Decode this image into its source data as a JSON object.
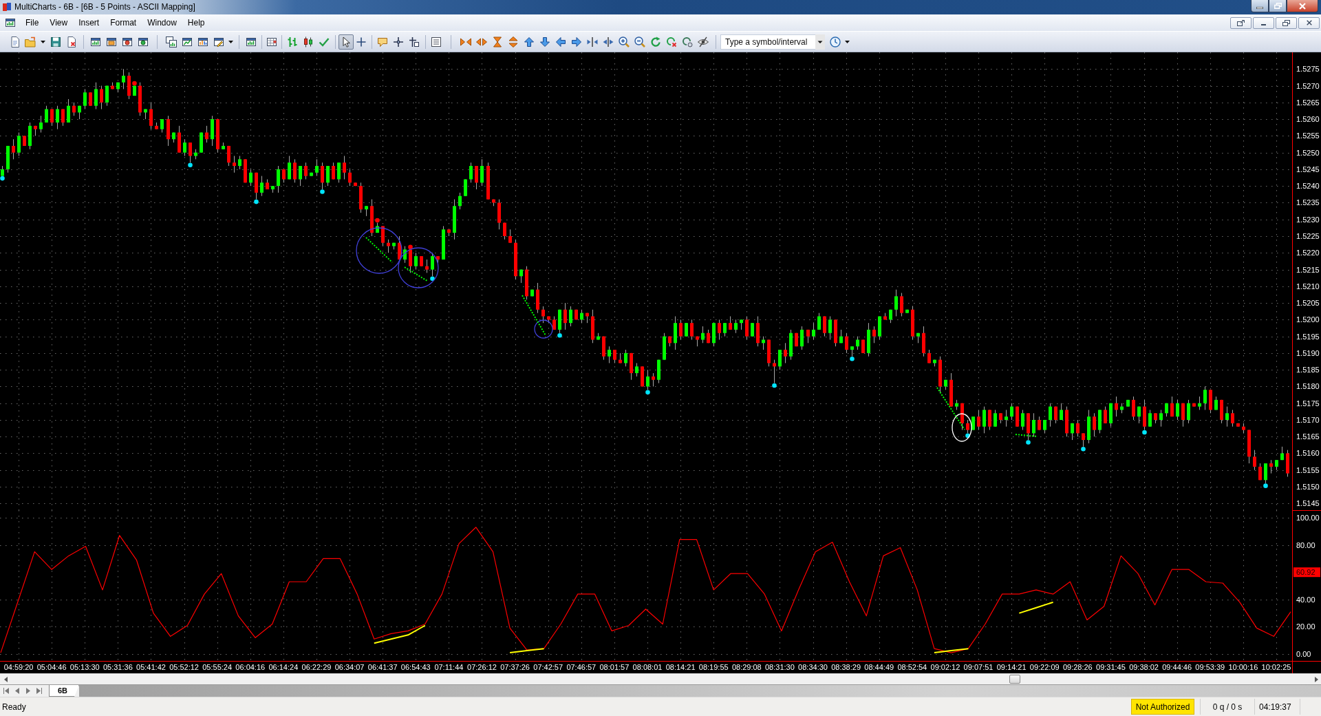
{
  "window": {
    "title": "MultiCharts - 6B - [6B - 5 Points - ASCII Mapping]"
  },
  "menu": [
    "File",
    "View",
    "Insert",
    "Format",
    "Window",
    "Help"
  ],
  "toolbar": {
    "cursor_modes": [
      {
        "selected": true
      },
      {
        "selected": false
      }
    ],
    "symbol_field": {
      "placeholder": "Type a symbol/interval"
    }
  },
  "price_chart": {
    "chart_data": {
      "type": "candlestick",
      "grid": true,
      "ylim": [
        1.5143,
        1.528
      ],
      "yticks": [
        {
          "value": 1.5275,
          "label": "1.5275"
        },
        {
          "value": 1.527,
          "label": "1.5270"
        },
        {
          "value": 1.5265,
          "label": "1.5265"
        },
        {
          "value": 1.526,
          "label": "1.5260"
        },
        {
          "value": 1.5255,
          "label": "1.5255"
        },
        {
          "value": 1.525,
          "label": "1.5250"
        },
        {
          "value": 1.5245,
          "label": "1.5245"
        },
        {
          "value": 1.524,
          "label": "1.5240"
        },
        {
          "value": 1.5235,
          "label": "1.5235"
        },
        {
          "value": 1.523,
          "label": "1.5230"
        },
        {
          "value": 1.5225,
          "label": "1.5225"
        },
        {
          "value": 1.522,
          "label": "1.5220"
        },
        {
          "value": 1.5215,
          "label": "1.5215"
        },
        {
          "value": 1.521,
          "label": "1.5210"
        },
        {
          "value": 1.5205,
          "label": "1.5205"
        },
        {
          "value": 1.52,
          "label": "1.5200"
        },
        {
          "value": 1.5195,
          "label": "1.5195"
        },
        {
          "value": 1.519,
          "label": "1.5190"
        },
        {
          "value": 1.5185,
          "label": "1.5185"
        },
        {
          "value": 1.518,
          "label": "1.5180"
        },
        {
          "value": 1.5175,
          "label": "1.5175"
        },
        {
          "value": 1.517,
          "label": "1.5170"
        },
        {
          "value": 1.5165,
          "label": "1.5165"
        },
        {
          "value": 1.516,
          "label": "1.5160"
        },
        {
          "value": 1.5155,
          "label": "1.5155"
        },
        {
          "value": 1.515,
          "label": "1.5150"
        },
        {
          "value": 1.5145,
          "label": "1.5145"
        }
      ],
      "ohlc": [
        [
          1.5243,
          1.5246,
          1.5243,
          1.5245
        ],
        [
          1.5245,
          1.5252,
          1.5244,
          1.5252
        ],
        [
          1.5252,
          1.5254,
          1.5248,
          1.525
        ],
        [
          1.525,
          1.5256,
          1.5249,
          1.5255
        ],
        [
          1.5255,
          1.5255,
          1.5252,
          1.5252
        ],
        [
          1.5252,
          1.5259,
          1.5251,
          1.5258
        ],
        [
          1.5258,
          1.5258,
          1.5255,
          1.5257
        ],
        [
          1.5257,
          1.5261,
          1.5256,
          1.5259
        ],
        [
          1.5259,
          1.5264,
          1.5259,
          1.5263
        ],
        [
          1.5263,
          1.5263,
          1.5258,
          1.5259
        ],
        [
          1.5259,
          1.5264,
          1.5257,
          1.5263
        ],
        [
          1.5263,
          1.5263,
          1.5258,
          1.5259
        ],
        [
          1.5259,
          1.5266,
          1.5259,
          1.5264
        ],
        [
          1.5264,
          1.5265,
          1.5261,
          1.5262
        ],
        [
          1.5262,
          1.5264,
          1.526,
          1.5264
        ],
        [
          1.5264,
          1.5269,
          1.5263,
          1.5268
        ],
        [
          1.5268,
          1.5268,
          1.5264,
          1.5264
        ],
        [
          1.5264,
          1.5271,
          1.5263,
          1.5269
        ],
        [
          1.5269,
          1.527,
          1.5263,
          1.5265
        ],
        [
          1.5265,
          1.527,
          1.5264,
          1.527
        ],
        [
          1.527,
          1.5271,
          1.5269,
          1.5269
        ],
        [
          1.5269,
          1.5271,
          1.5268,
          1.5271
        ],
        [
          1.5271,
          1.5275,
          1.5269,
          1.5273
        ],
        [
          1.5273,
          1.5274,
          1.5266,
          1.5267
        ],
        [
          1.5267,
          1.527,
          1.5267,
          1.527
        ],
        [
          1.527,
          1.5271,
          1.5261,
          1.5262
        ],
        [
          1.5262,
          1.5263,
          1.526,
          1.5263
        ],
        [
          1.5263,
          1.5265,
          1.5257,
          1.5258
        ],
        [
          1.5258,
          1.5259,
          1.5257,
          1.5257
        ],
        [
          1.5257,
          1.526,
          1.5256,
          1.526
        ],
        [
          1.526,
          1.5261,
          1.5252,
          1.5254
        ],
        [
          1.5254,
          1.5256,
          1.5253,
          1.5256
        ],
        [
          1.5256,
          1.5258,
          1.525,
          1.525
        ],
        [
          1.525,
          1.5254,
          1.5249,
          1.5253
        ],
        [
          1.5253,
          1.5253,
          1.5247,
          1.5249
        ],
        [
          1.5249,
          1.5251,
          1.5248,
          1.525
        ],
        [
          1.525,
          1.5256,
          1.525,
          1.5256
        ],
        [
          1.5256,
          1.5258,
          1.5253,
          1.5254
        ],
        [
          1.5254,
          1.5261,
          1.5252,
          1.526
        ],
        [
          1.526,
          1.526,
          1.525,
          1.5251
        ],
        [
          1.5251,
          1.5253,
          1.5251,
          1.5252
        ],
        [
          1.5252,
          1.5252,
          1.5246,
          1.5247
        ],
        [
          1.5247,
          1.5249,
          1.5244,
          1.5246
        ],
        [
          1.5246,
          1.5249,
          1.5245,
          1.5248
        ],
        [
          1.5248,
          1.5248,
          1.5241,
          1.5241
        ],
        [
          1.5241,
          1.5245,
          1.524,
          1.5244
        ],
        [
          1.5244,
          1.5244,
          1.5236,
          1.5238
        ],
        [
          1.5238,
          1.5243,
          1.5237,
          1.5241
        ],
        [
          1.5241,
          1.5242,
          1.5239,
          1.5239
        ],
        [
          1.5239,
          1.524,
          1.5238,
          1.524
        ],
        [
          1.524,
          1.5246,
          1.5238,
          1.5245
        ],
        [
          1.5245,
          1.5245,
          1.5241,
          1.5242
        ],
        [
          1.5242,
          1.5249,
          1.5242,
          1.5247
        ],
        [
          1.5247,
          1.5248,
          1.5241,
          1.5242
        ],
        [
          1.5242,
          1.5246,
          1.524,
          1.5246
        ],
        [
          1.5246,
          1.5247,
          1.5242,
          1.5243
        ],
        [
          1.5243,
          1.5244,
          1.5243,
          1.5244
        ],
        [
          1.5244,
          1.5248,
          1.5243,
          1.5246
        ],
        [
          1.5246,
          1.5247,
          1.5239,
          1.5241
        ],
        [
          1.5241,
          1.5246,
          1.524,
          1.5246
        ],
        [
          1.5246,
          1.5247,
          1.5242,
          1.5242
        ],
        [
          1.5242,
          1.5247,
          1.5241,
          1.5247
        ],
        [
          1.5247,
          1.5249,
          1.5242,
          1.5244
        ],
        [
          1.5244,
          1.5245,
          1.524,
          1.5241
        ],
        [
          1.5241,
          1.5241,
          1.524,
          1.524
        ],
        [
          1.524,
          1.5241,
          1.5232,
          1.5233
        ],
        [
          1.5233,
          1.5234,
          1.5231,
          1.5234
        ],
        [
          1.5234,
          1.5236,
          1.5225,
          1.5226
        ],
        [
          1.5226,
          1.5229,
          1.5226,
          1.5228
        ],
        [
          1.5228,
          1.5228,
          1.5222,
          1.5223
        ],
        [
          1.5223,
          1.5224,
          1.522,
          1.5222
        ],
        [
          1.5222,
          1.5223,
          1.5221,
          1.5223
        ],
        [
          1.5223,
          1.5225,
          1.5218,
          1.5218
        ],
        [
          1.5218,
          1.5222,
          1.5217,
          1.5221
        ],
        [
          1.5221,
          1.5221,
          1.5214,
          1.5216
        ],
        [
          1.5216,
          1.522,
          1.5215,
          1.5219
        ],
        [
          1.5219,
          1.5219,
          1.5216,
          1.5216
        ],
        [
          1.5216,
          1.5218,
          1.5214,
          1.5215
        ],
        [
          1.5215,
          1.522,
          1.5213,
          1.5219
        ],
        [
          1.5219,
          1.5219,
          1.5217,
          1.5218
        ],
        [
          1.5218,
          1.5228,
          1.5218,
          1.5227
        ],
        [
          1.5227,
          1.5227,
          1.5225,
          1.5226
        ],
        [
          1.5226,
          1.5236,
          1.5224,
          1.5234
        ],
        [
          1.5234,
          1.5238,
          1.5233,
          1.5237
        ],
        [
          1.5237,
          1.5242,
          1.5237,
          1.5242
        ],
        [
          1.5242,
          1.5247,
          1.5241,
          1.5246
        ],
        [
          1.5246,
          1.5246,
          1.5239,
          1.5241
        ],
        [
          1.5241,
          1.5248,
          1.524,
          1.5246
        ],
        [
          1.5246,
          1.5247,
          1.5236,
          1.5236
        ],
        [
          1.5236,
          1.5236,
          1.5234,
          1.5235
        ],
        [
          1.5235,
          1.5236,
          1.5227,
          1.5229
        ],
        [
          1.5229,
          1.5229,
          1.5224,
          1.5225
        ],
        [
          1.5225,
          1.5227,
          1.5223,
          1.5223
        ],
        [
          1.5223,
          1.5224,
          1.5212,
          1.5213
        ],
        [
          1.5213,
          1.5215,
          1.5211,
          1.5215
        ],
        [
          1.5215,
          1.5216,
          1.5206,
          1.5207
        ],
        [
          1.5207,
          1.5209,
          1.5207,
          1.5209
        ],
        [
          1.5209,
          1.5211,
          1.5202,
          1.5203
        ],
        [
          1.5203,
          1.5204,
          1.5199,
          1.5201
        ],
        [
          1.5201,
          1.5201,
          1.5199,
          1.52
        ],
        [
          1.52,
          1.5201,
          1.5197,
          1.5197
        ],
        [
          1.5197,
          1.5203,
          1.5196,
          1.5203
        ],
        [
          1.5203,
          1.5205,
          1.5197,
          1.5199
        ],
        [
          1.5199,
          1.5204,
          1.5198,
          1.5203
        ],
        [
          1.5203,
          1.5203,
          1.52,
          1.52
        ],
        [
          1.52,
          1.5203,
          1.5199,
          1.5202
        ],
        [
          1.5202,
          1.5202,
          1.5199,
          1.5201
        ],
        [
          1.5201,
          1.5203,
          1.5193,
          1.5194
        ],
        [
          1.5194,
          1.5196,
          1.5194,
          1.5195
        ],
        [
          1.5195,
          1.5195,
          1.5188,
          1.5189
        ],
        [
          1.5189,
          1.5192,
          1.5187,
          1.5191
        ],
        [
          1.5191,
          1.5191,
          1.5187,
          1.5188
        ],
        [
          1.5188,
          1.519,
          1.5187,
          1.5187
        ],
        [
          1.5187,
          1.5191,
          1.5186,
          1.519
        ],
        [
          1.519,
          1.519,
          1.5182,
          1.5184
        ],
        [
          1.5184,
          1.5187,
          1.5183,
          1.5186
        ],
        [
          1.5186,
          1.5186,
          1.518,
          1.518
        ],
        [
          1.518,
          1.5185,
          1.5179,
          1.5183
        ],
        [
          1.5183,
          1.5184,
          1.518,
          1.5182
        ],
        [
          1.5182,
          1.5188,
          1.5181,
          1.5188
        ],
        [
          1.5188,
          1.5196,
          1.5188,
          1.5195
        ],
        [
          1.5195,
          1.5195,
          1.5192,
          1.5193
        ],
        [
          1.5193,
          1.5201,
          1.5191,
          1.5199
        ],
        [
          1.5199,
          1.52,
          1.5194,
          1.5195
        ],
        [
          1.5195,
          1.5199,
          1.5195,
          1.5199
        ],
        [
          1.5199,
          1.52,
          1.5194,
          1.5195
        ],
        [
          1.5195,
          1.5195,
          1.5192,
          1.5194
        ],
        [
          1.5194,
          1.5198,
          1.5193,
          1.5196
        ],
        [
          1.5196,
          1.5197,
          1.5193,
          1.5193
        ],
        [
          1.5193,
          1.5199,
          1.5192,
          1.5199
        ],
        [
          1.5199,
          1.52,
          1.5194,
          1.5196
        ],
        [
          1.5196,
          1.5199,
          1.5195,
          1.5199
        ],
        [
          1.5199,
          1.5201,
          1.5197,
          1.5197
        ],
        [
          1.5197,
          1.52,
          1.5196,
          1.5199
        ],
        [
          1.5199,
          1.52,
          1.5197,
          1.52
        ],
        [
          1.52,
          1.5201,
          1.5194,
          1.5195
        ],
        [
          1.5195,
          1.5199,
          1.5195,
          1.5199
        ],
        [
          1.5199,
          1.5201,
          1.5192,
          1.5193
        ],
        [
          1.5193,
          1.5195,
          1.5191,
          1.5194
        ],
        [
          1.5194,
          1.5194,
          1.5186,
          1.5187
        ],
        [
          1.5187,
          1.5188,
          1.5181,
          1.5186
        ],
        [
          1.5186,
          1.5191,
          1.5185,
          1.5191
        ],
        [
          1.5191,
          1.5193,
          1.5187,
          1.5189
        ],
        [
          1.5189,
          1.5197,
          1.5188,
          1.5196
        ],
        [
          1.5196,
          1.5196,
          1.5192,
          1.5192
        ],
        [
          1.5192,
          1.5198,
          1.5191,
          1.5197
        ],
        [
          1.5197,
          1.5197,
          1.5193,
          1.5195
        ],
        [
          1.5195,
          1.5199,
          1.5194,
          1.5197
        ],
        [
          1.5197,
          1.5202,
          1.5197,
          1.5201
        ],
        [
          1.5201,
          1.5201,
          1.5195,
          1.5196
        ],
        [
          1.5196,
          1.5201,
          1.5194,
          1.52
        ],
        [
          1.52,
          1.52,
          1.5192,
          1.5193
        ],
        [
          1.5193,
          1.5197,
          1.5193,
          1.5195
        ],
        [
          1.5195,
          1.5196,
          1.519,
          1.5191
        ],
        [
          1.5191,
          1.5192,
          1.5189,
          1.5192
        ],
        [
          1.5192,
          1.5195,
          1.5191,
          1.5194
        ],
        [
          1.5194,
          1.5194,
          1.519,
          1.519
        ],
        [
          1.519,
          1.5199,
          1.5189,
          1.5197
        ],
        [
          1.5197,
          1.5198,
          1.5193,
          1.5195
        ],
        [
          1.5195,
          1.5201,
          1.5194,
          1.5201
        ],
        [
          1.5201,
          1.5202,
          1.52,
          1.52
        ],
        [
          1.52,
          1.5203,
          1.5199,
          1.5203
        ],
        [
          1.5203,
          1.5209,
          1.5201,
          1.5207
        ],
        [
          1.5207,
          1.5208,
          1.5201,
          1.5202
        ],
        [
          1.5202,
          1.5203,
          1.5202,
          1.5203
        ],
        [
          1.5203,
          1.5204,
          1.5194,
          1.5195
        ],
        [
          1.5195,
          1.5196,
          1.5193,
          1.5196
        ],
        [
          1.5196,
          1.5198,
          1.5189,
          1.519
        ],
        [
          1.519,
          1.5191,
          1.5187,
          1.5187
        ],
        [
          1.5187,
          1.5188,
          1.5186,
          1.5188
        ],
        [
          1.5188,
          1.5189,
          1.5178,
          1.518
        ],
        [
          1.518,
          1.5182,
          1.5179,
          1.5182
        ],
        [
          1.5182,
          1.5184,
          1.5174,
          1.5174
        ],
        [
          1.5174,
          1.5176,
          1.5173,
          1.5175
        ],
        [
          1.5175,
          1.5175,
          1.5167,
          1.5169
        ],
        [
          1.5169,
          1.517,
          1.5166,
          1.5167
        ],
        [
          1.5167,
          1.5171,
          1.5167,
          1.5171
        ],
        [
          1.5171,
          1.5173,
          1.5167,
          1.5168
        ],
        [
          1.5168,
          1.5174,
          1.5166,
          1.5173
        ],
        [
          1.5173,
          1.5173,
          1.5167,
          1.5168
        ],
        [
          1.5168,
          1.5173,
          1.5168,
          1.5172
        ],
        [
          1.5172,
          1.5172,
          1.5169,
          1.517
        ],
        [
          1.517,
          1.5173,
          1.5168,
          1.5171
        ],
        [
          1.5171,
          1.5175,
          1.517,
          1.5174
        ],
        [
          1.5174,
          1.5174,
          1.5168,
          1.5168
        ],
        [
          1.5168,
          1.5173,
          1.5167,
          1.5172
        ],
        [
          1.5172,
          1.5172,
          1.5164,
          1.5166
        ],
        [
          1.5166,
          1.5172,
          1.5165,
          1.517
        ],
        [
          1.517,
          1.5171,
          1.5167,
          1.5167
        ],
        [
          1.5167,
          1.517,
          1.5166,
          1.517
        ],
        [
          1.517,
          1.5175,
          1.5168,
          1.5174
        ],
        [
          1.5174,
          1.5174,
          1.5169,
          1.517
        ],
        [
          1.517,
          1.5175,
          1.517,
          1.5173
        ],
        [
          1.5173,
          1.5174,
          1.5165,
          1.5166
        ],
        [
          1.5166,
          1.5169,
          1.5164,
          1.5169
        ],
        [
          1.5169,
          1.517,
          1.5165,
          1.5166
        ],
        [
          1.5166,
          1.5166,
          1.5162,
          1.5164
        ],
        [
          1.5164,
          1.5173,
          1.5163,
          1.5171
        ],
        [
          1.5171,
          1.5172,
          1.5165,
          1.5167
        ],
        [
          1.5167,
          1.5173,
          1.5166,
          1.5173
        ],
        [
          1.5173,
          1.5174,
          1.5169,
          1.5169
        ],
        [
          1.5169,
          1.5175,
          1.5168,
          1.5175
        ],
        [
          1.5175,
          1.5177,
          1.5171,
          1.5173
        ],
        [
          1.5173,
          1.5175,
          1.5172,
          1.5174
        ],
        [
          1.5174,
          1.5176,
          1.5174,
          1.5176
        ],
        [
          1.5176,
          1.5177,
          1.517,
          1.5171
        ],
        [
          1.5171,
          1.5174,
          1.5169,
          1.5174
        ],
        [
          1.5174,
          1.5176,
          1.5167,
          1.5168
        ],
        [
          1.5168,
          1.5173,
          1.5168,
          1.5172
        ],
        [
          1.5172,
          1.5172,
          1.5169,
          1.517
        ],
        [
          1.517,
          1.5173,
          1.5168,
          1.5172
        ],
        [
          1.5172,
          1.5175,
          1.5171,
          1.5175
        ],
        [
          1.5175,
          1.5177,
          1.5171,
          1.5171
        ],
        [
          1.5171,
          1.5176,
          1.517,
          1.5175
        ],
        [
          1.5175,
          1.5175,
          1.5168,
          1.517
        ],
        [
          1.517,
          1.5176,
          1.5169,
          1.5175
        ],
        [
          1.5175,
          1.5175,
          1.5174,
          1.5174
        ],
        [
          1.5174,
          1.5177,
          1.5173,
          1.5175
        ],
        [
          1.5175,
          1.518,
          1.5173,
          1.5179
        ],
        [
          1.5179,
          1.5179,
          1.5172,
          1.5173
        ],
        [
          1.5173,
          1.5177,
          1.5173,
          1.5176
        ],
        [
          1.5176,
          1.5176,
          1.5169,
          1.517
        ],
        [
          1.517,
          1.5174,
          1.5168,
          1.5172
        ],
        [
          1.5172,
          1.5173,
          1.5168,
          1.5169
        ],
        [
          1.5169,
          1.5169,
          1.5168,
          1.5168
        ],
        [
          1.5168,
          1.5169,
          1.5166,
          1.5167
        ],
        [
          1.5167,
          1.5167,
          1.5157,
          1.5159
        ],
        [
          1.5159,
          1.5161,
          1.5155,
          1.5156
        ],
        [
          1.5156,
          1.5157,
          1.5152,
          1.5152
        ],
        [
          1.5152,
          1.5157,
          1.5151,
          1.5157
        ],
        [
          1.5157,
          1.5158,
          1.5154,
          1.5156
        ],
        [
          1.5156,
          1.5158,
          1.5155,
          1.5158
        ],
        [
          1.5158,
          1.5162,
          1.5158,
          1.516
        ],
        [
          1.516,
          1.5161,
          1.5153,
          1.5154
        ]
      ]
    }
  },
  "oscillator": {
    "current_value": "60.92",
    "chart_data": {
      "type": "line",
      "grid": true,
      "ylim": [
        -5,
        105.5
      ],
      "yticks": [
        {
          "value": 0,
          "label": "0.00"
        },
        {
          "value": 20,
          "label": "20.00"
        },
        {
          "value": 40,
          "label": "40.00"
        },
        {
          "value": 80,
          "label": "80.00"
        },
        {
          "value": 100,
          "label": "100.00"
        }
      ],
      "series": [
        {
          "color": "#ff0000",
          "values": [
            1,
            38,
            75,
            62,
            72,
            79,
            47,
            87,
            69,
            30,
            13,
            21,
            44,
            59,
            28,
            12,
            22,
            53,
            53,
            70,
            70,
            44,
            11,
            15,
            17,
            22,
            44,
            81,
            93,
            75,
            19,
            3,
            4,
            22,
            44,
            44,
            17,
            21,
            33,
            22,
            84,
            84,
            47,
            59,
            59,
            44,
            17,
            47,
            75,
            82,
            53,
            28,
            72,
            78,
            47,
            4,
            1,
            4,
            22,
            44,
            44,
            47,
            44,
            53,
            25,
            35,
            72,
            59,
            36,
            62,
            62,
            53,
            52,
            38,
            19,
            13,
            31
          ]
        },
        {
          "color": "#ffff00",
          "values": [
            null,
            null,
            null,
            null,
            null,
            null,
            null,
            null,
            null,
            null,
            null,
            null,
            null,
            null,
            null,
            null,
            null,
            null,
            null,
            null,
            null,
            null,
            8,
            11,
            14,
            21,
            null,
            null,
            null,
            null,
            1,
            2.5,
            4,
            null,
            null,
            null,
            null,
            null,
            null,
            null,
            null,
            null,
            null,
            null,
            null,
            null,
            null,
            null,
            null,
            null,
            null,
            null,
            null,
            null,
            null,
            1,
            2.5,
            4,
            null,
            null,
            30,
            34,
            38,
            null,
            null,
            null,
            null,
            null,
            null,
            null,
            null,
            null,
            null,
            null,
            null,
            null,
            null
          ]
        }
      ]
    }
  },
  "time_axis": {
    "labels": [
      "04:59:20",
      "05:04:46",
      "05:13:30",
      "05:31:36",
      "05:41:42",
      "05:52:12",
      "05:55:24",
      "06:04:16",
      "06:14:24",
      "06:22:29",
      "06:34:07",
      "06:41:37",
      "06:54:43",
      "07:11:44",
      "07:26:12",
      "07:37:26",
      "07:42:57",
      "07:46:57",
      "08:01:57",
      "08:08:01",
      "08:14:21",
      "08:19:55",
      "08:29:08",
      "08:31:30",
      "08:34:30",
      "08:38:29",
      "08:44:49",
      "08:52:54",
      "09:02:12",
      "09:07:51",
      "09:14:21",
      "09:22:09",
      "09:28:26",
      "09:31:45",
      "09:38:02",
      "09:44:46",
      "09:53:39",
      "10:00:16",
      "10:02:25"
    ]
  },
  "sheet_tabs": [
    {
      "label": "6B",
      "selected": true
    }
  ],
  "status_bar": {
    "message": "Ready",
    "panels": [
      {
        "text": "Not Authorized",
        "highlighted": true
      },
      {
        "text": "0 q / 0 s",
        "highlighted": false
      },
      {
        "text": "04:19:37",
        "highlighted": false
      }
    ]
  }
}
